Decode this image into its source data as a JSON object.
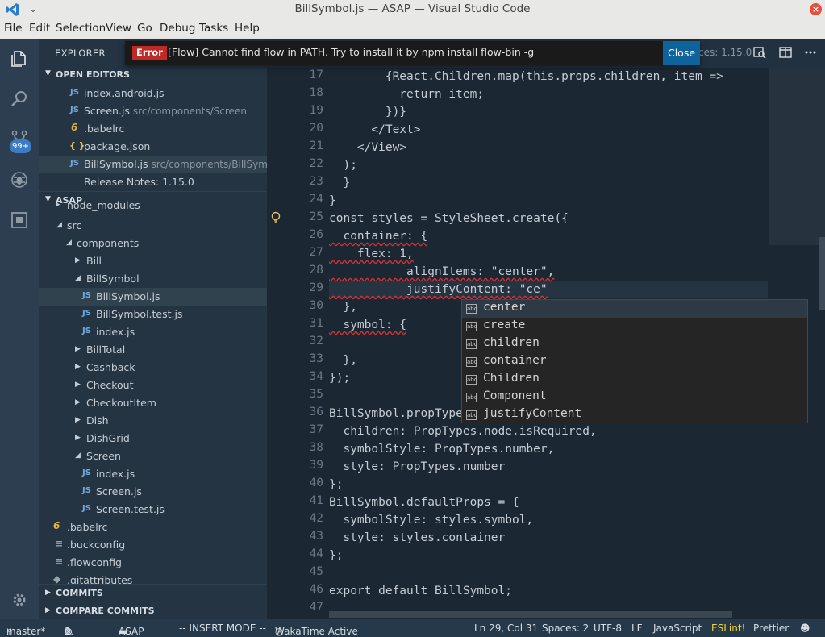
{
  "window": {
    "title": "BillSymbol.js — ASAP — Visual Studio Code",
    "close": "×"
  },
  "menu": [
    "File",
    "Edit",
    "Selection",
    "View",
    "Go",
    "Debug",
    "Tasks",
    "Help"
  ],
  "activity": {
    "badge": "99+"
  },
  "sidebar": {
    "header": "EXPLORER",
    "open_editors_label": "OPEN EDITORS",
    "open_editors": [
      {
        "icon": "JS",
        "name": "index.android.js",
        "path": ""
      },
      {
        "icon": "JS",
        "name": "Screen.js",
        "path": "src/components/Screen"
      },
      {
        "icon": "6",
        "name": ".babelrc",
        "path": ""
      },
      {
        "icon": "{ }",
        "name": "package.json",
        "path": ""
      },
      {
        "icon": "JS",
        "name": "BillSymbol.js",
        "path": "src/components/BillSym..."
      },
      {
        "icon": "",
        "name": "Release Notes: 1.15.0",
        "path": ""
      }
    ],
    "project_label": "ASAP",
    "tree": [
      "node_modules",
      "src",
      "components",
      "Bill",
      "BillSymbol",
      "BillSymbol.js",
      "BillSymbol.test.js",
      "index.js",
      "BillTotal",
      "Cashback",
      "Checkout",
      "CheckoutItem",
      "Dish",
      "DishGrid",
      "Screen",
      "index.js",
      "Screen.js",
      "Screen.test.js",
      ".babelrc",
      ".buckconfig",
      ".flowconfig",
      ".gitattributes"
    ],
    "commits_label": "COMMITS",
    "compare_label": "COMPARE COMMITS"
  },
  "notification": {
    "severity": "Error",
    "message": "[Flow] Cannot find flow in PATH. Try to install it by npm install flow-bin -g",
    "button": "Close"
  },
  "tabs": {
    "partial_text": "ces: 1.15.0"
  },
  "editor": {
    "line_numbers": [
      "17",
      "18",
      "19",
      "20",
      "21",
      "22",
      "23",
      "24",
      "25",
      "26",
      "27",
      "28",
      "29",
      "30",
      "31",
      "32",
      "33",
      "34",
      "35",
      "36",
      "37",
      "38",
      "39",
      "40",
      "41",
      "42",
      "43",
      "44",
      "45",
      "46",
      "47"
    ],
    "code": [
      "        {React.Children.map(this.props.children, item =>",
      "          return item;",
      "        })}",
      "      </Text>",
      "    </View>",
      "  );",
      "  }",
      "}",
      "const styles = StyleSheet.create({",
      "  container: {",
      "    flex: 1,",
      "           alignItems: \"center\",",
      "           justifyContent: \"ce\"",
      "  },",
      "  symbol: {",
      "",
      "  },",
      "});",
      "",
      "BillSymbol.propTypes = {",
      "  children: PropTypes.node.isRequired,",
      "  symbolStyle: PropTypes.number,",
      "  style: PropTypes.number",
      "};",
      "BillSymbol.defaultProps = {",
      "  symbolStyle: styles.symbol,",
      "  style: styles.container",
      "};",
      "",
      "export default BillSymbol;",
      ""
    ]
  },
  "suggestions": [
    "center",
    "create",
    "children",
    "container",
    "Children",
    "Component",
    "justifyContent"
  ],
  "suggestion_icon": "abc",
  "status": {
    "branch": "master*",
    "errors": "1",
    "warnings": "0",
    "folder": "ASAP",
    "mode": "-- INSERT MODE --",
    "wakatime": "WakaTime Active",
    "position": "Ln 29, Col 31",
    "spaces": "Spaces: 2",
    "encoding": "UTF-8",
    "eol": "LF",
    "language": "JavaScript",
    "eslint": "ESLint!",
    "prettier": "Prettier"
  }
}
